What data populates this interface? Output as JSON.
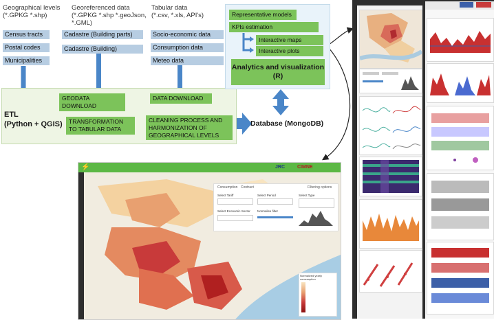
{
  "sources": {
    "geographical": {
      "title_lines": [
        "Geographical levels",
        "(*.GPKG *.shp)"
      ],
      "items": [
        "Census tracts",
        "Postal codes",
        "Municipalities"
      ]
    },
    "georeferenced": {
      "title_lines": [
        "Georeferenced data",
        "(*.GPKG *.shp *.geoJson,",
        "*.GML)"
      ],
      "items": [
        "Cadastre (Building parts)",
        "Cadastre (Building)"
      ]
    },
    "tabular": {
      "title_lines": [
        "Tabular data",
        "(*.csv, *.xls, API's)"
      ],
      "items": [
        "Socio-economic data",
        "Consumption data",
        "Meteo data"
      ]
    }
  },
  "etl": {
    "label_lines": [
      "ETL",
      "(Python + QGIS)"
    ],
    "geodata_download": "GEODATA DOWNLOAD",
    "data_download": "DATA DOWNLOAD",
    "transformation_lines": [
      "TRANSFORMATION",
      "TO TABULAR DATA"
    ],
    "cleaning_lines": [
      "CLEANING PROCESS AND",
      "HARMONIZATION OF",
      "GEOGRAPHICAL LEVELS"
    ]
  },
  "database": "Database (MongoDB)",
  "analytics": {
    "items": [
      "Representative models",
      "KPIs estimation",
      "Interactive maps",
      "Interactive plots"
    ],
    "title_lines": [
      "Analytics and visualization",
      "(R)"
    ]
  },
  "dashboard": {
    "tabs": [
      "Consumption",
      "Contract",
      "Filtering options"
    ],
    "filters": [
      "Select Tariff",
      "Select Period",
      "Select Type",
      "Select Economic Sector",
      "Normalise filter"
    ],
    "legend_title": "Normalized yearly consumption",
    "logos": [
      "JRC",
      "CIMNE"
    ]
  },
  "colors": {
    "green": "#7cc35a",
    "blue_box": "#b7cde2",
    "arrow": "#4a86c8",
    "dark_bg": "#2e2e2e"
  }
}
